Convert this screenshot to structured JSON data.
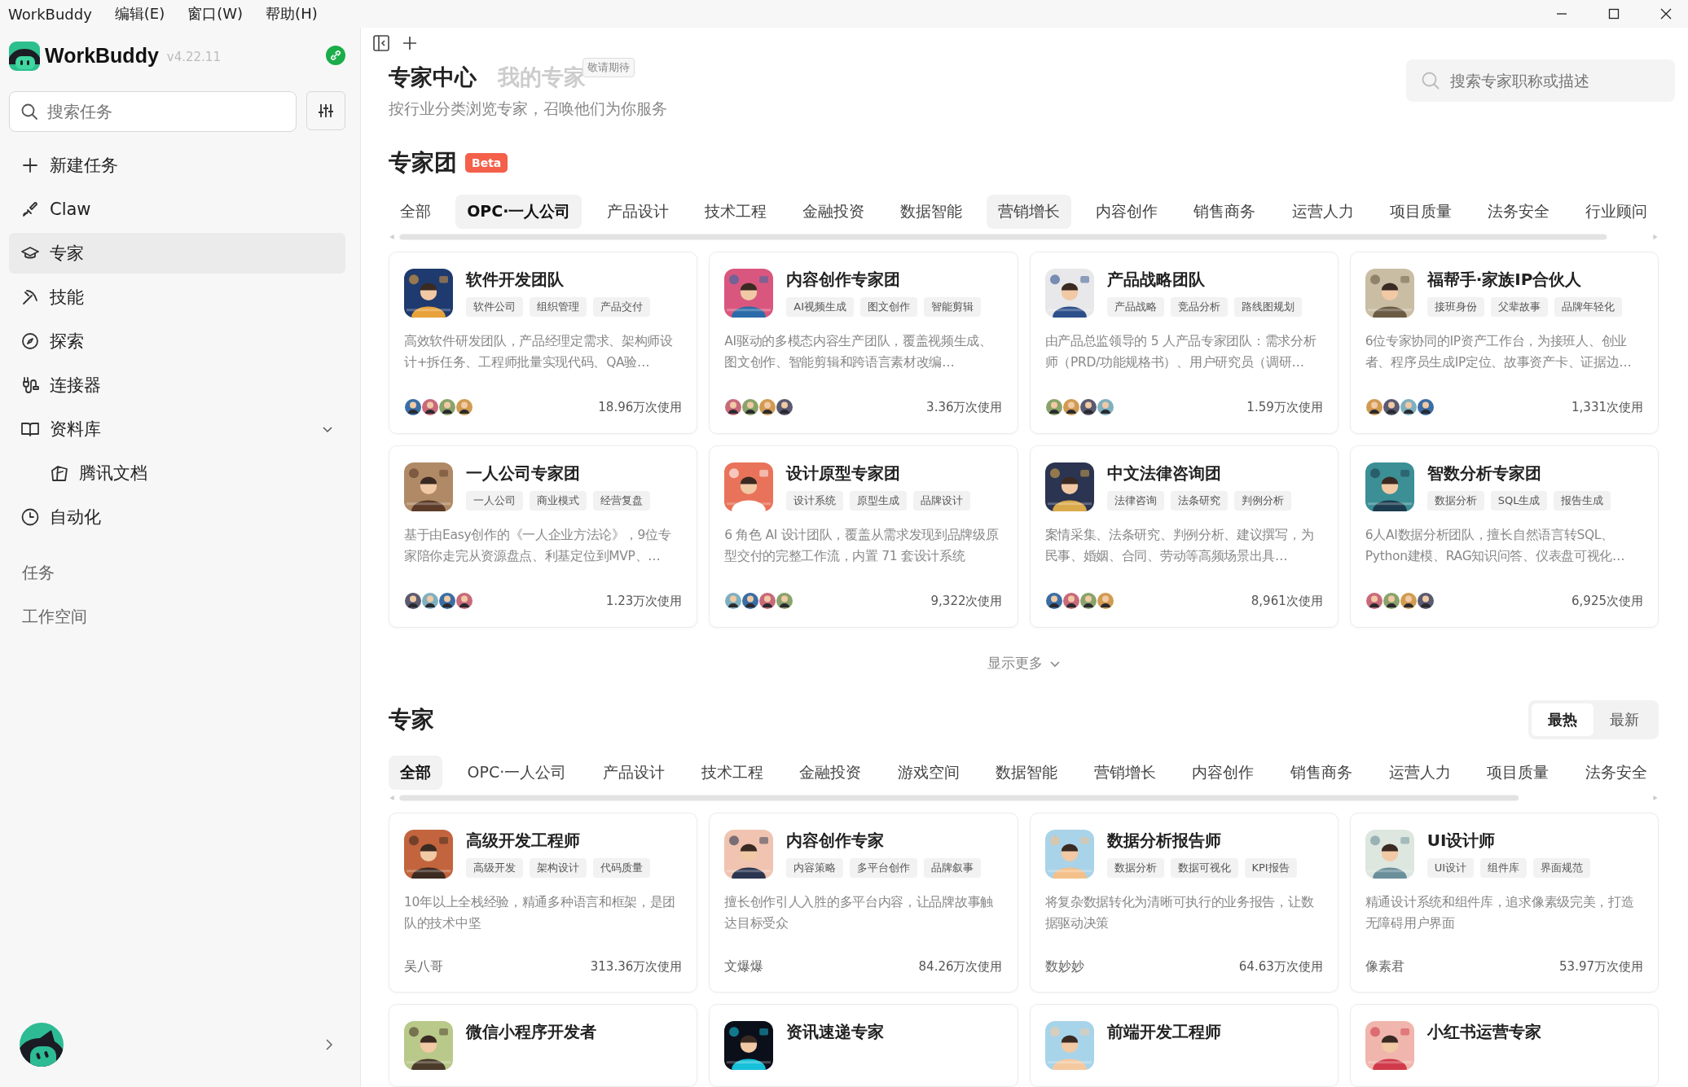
{
  "menubar": {
    "app_name": "WorkBuddy",
    "menus": [
      "编辑(E)",
      "窗口(W)",
      "帮助(H)"
    ]
  },
  "sidebar": {
    "brand": "WorkBuddy",
    "version": "v4.22.11",
    "search": {
      "placeholder": "搜索任务"
    },
    "items": [
      {
        "label": "新建任务",
        "selected": false
      },
      {
        "label": "Claw",
        "selected": false
      },
      {
        "label": "专家",
        "selected": true
      },
      {
        "label": "技能",
        "selected": false
      },
      {
        "label": "探索",
        "selected": false
      },
      {
        "label": "连接器",
        "selected": false
      },
      {
        "label": "资料库",
        "selected": false,
        "expanded": true,
        "children": [
          {
            "label": "腾讯文档",
            "selected": false
          }
        ]
      },
      {
        "label": "自动化",
        "selected": false
      }
    ],
    "sections": [
      "任务",
      "工作空间"
    ]
  },
  "header": {
    "tabs": [
      {
        "label": "专家中心",
        "selected": true
      },
      {
        "label": "我的专家",
        "selected": false,
        "badge": "敬请期待"
      }
    ],
    "subtitle": "按行业分类浏览专家，召唤他们为你服务",
    "search": {
      "placeholder": "搜索专家职称或描述"
    }
  },
  "teams": {
    "title": "专家团",
    "badge": "Beta",
    "tabs": [
      {
        "label": "全部",
        "selected": false,
        "hover": false
      },
      {
        "label": "OPC·一人公司",
        "selected": true,
        "hover": false
      },
      {
        "label": "产品设计",
        "selected": false,
        "hover": false
      },
      {
        "label": "技术工程",
        "selected": false,
        "hover": false
      },
      {
        "label": "金融投资",
        "selected": false,
        "hover": false
      },
      {
        "label": "数据智能",
        "selected": false,
        "hover": false
      },
      {
        "label": "营销增长",
        "selected": false,
        "hover": true
      },
      {
        "label": "内容创作",
        "selected": false,
        "hover": false
      },
      {
        "label": "销售商务",
        "selected": false,
        "hover": false
      },
      {
        "label": "运营人力",
        "selected": false,
        "hover": false
      },
      {
        "label": "项目质量",
        "selected": false,
        "hover": false
      },
      {
        "label": "法务安全",
        "selected": false,
        "hover": false
      },
      {
        "label": "行业顾问",
        "selected": false,
        "hover": false
      }
    ],
    "cards": [
      {
        "title": "软件开发团队",
        "tags": [
          "软件公司",
          "组织管理",
          "产品交付"
        ],
        "description": "高效软件研发团队，产品经理定需求、架构师设计+拆任务、工程师批量实现代码、QA验…",
        "usage": "18.96万次使用"
      },
      {
        "title": "内容创作专家团",
        "tags": [
          "AI视频生成",
          "图文创作",
          "智能剪辑"
        ],
        "description": "AI驱动的多模态内容生产团队，覆盖视频生成、图文创作、智能剪辑和跨语言素材改编…",
        "usage": "3.36万次使用"
      },
      {
        "title": "产品战略团队",
        "tags": [
          "产品战略",
          "竞品分析",
          "路线图规划"
        ],
        "description": "由产品总监领导的 5 人产品专家团队：需求分析师（PRD/功能规格书）、用户研究员（调研…",
        "usage": "1.59万次使用"
      },
      {
        "title": "福帮手·家族IP合伙人",
        "tags": [
          "接班身份",
          "父辈故事",
          "品牌年轻化"
        ],
        "description": "6位专家协同的IP资产工作台，为接班人、创业者、程序员生成IP定位、故事资产卡、证据边…",
        "usage": "1,331次使用"
      },
      {
        "title": "一人公司专家团",
        "tags": [
          "一人公司",
          "商业模式",
          "经营复盘"
        ],
        "description": "基于由Easy创作的《一人企业方法论》，9位专家陪你走完从资源盘点、利基定位到MVP、…",
        "usage": "1.23万次使用"
      },
      {
        "title": "设计原型专家团",
        "tags": [
          "设计系统",
          "原型生成",
          "品牌设计"
        ],
        "description": "6 角色 AI 设计团队，覆盖从需求发现到品牌级原型交付的完整工作流，内置 71 套设计系统",
        "usage": "9,322次使用"
      },
      {
        "title": "中文法律咨询团",
        "tags": [
          "法律咨询",
          "法条研究",
          "判例分析"
        ],
        "description": "案情采集、法条研究、判例分析、建议撰写，为民事、婚姻、合同、劳动等高频场景出具…",
        "usage": "8,961次使用"
      },
      {
        "title": "智数分析专家团",
        "tags": [
          "数据分析",
          "SQL生成",
          "报告生成"
        ],
        "description": "6人AI数据分析团队，擅长自然语言转SQL、Python建模、RAG知识问答、仪表盘可视化…",
        "usage": "6,925次使用"
      }
    ],
    "show_more": "显示更多"
  },
  "experts": {
    "title": "专家",
    "sort": [
      {
        "label": "最热",
        "selected": true
      },
      {
        "label": "最新",
        "selected": false
      }
    ],
    "tabs": [
      {
        "label": "全部",
        "selected": true,
        "hover": false
      },
      {
        "label": "OPC·一人公司",
        "selected": false,
        "hover": false
      },
      {
        "label": "产品设计",
        "selected": false,
        "hover": false
      },
      {
        "label": "技术工程",
        "selected": false,
        "hover": false
      },
      {
        "label": "金融投资",
        "selected": false,
        "hover": false
      },
      {
        "label": "游戏空间",
        "selected": false,
        "hover": false
      },
      {
        "label": "数据智能",
        "selected": false,
        "hover": false
      },
      {
        "label": "营销增长",
        "selected": false,
        "hover": false
      },
      {
        "label": "内容创作",
        "selected": false,
        "hover": false
      },
      {
        "label": "销售商务",
        "selected": false,
        "hover": false
      },
      {
        "label": "运营人力",
        "selected": false,
        "hover": false
      },
      {
        "label": "项目质量",
        "selected": false,
        "hover": false
      },
      {
        "label": "法务安全",
        "selected": false,
        "hover": false
      }
    ],
    "cards": [
      {
        "title": "高级开发工程师",
        "tags": [
          "高级开发",
          "架构设计",
          "代码质量"
        ],
        "description": "10年以上全栈经验，精通多种语言和框架，是团队的技术中坚",
        "author": "吴八哥",
        "usage": "313.36万次使用"
      },
      {
        "title": "内容创作专家",
        "tags": [
          "内容策略",
          "多平台创作",
          "品牌叙事"
        ],
        "description": "擅长创作引人入胜的多平台内容，让品牌故事触达目标受众",
        "author": "文爆爆",
        "usage": "84.26万次使用"
      },
      {
        "title": "数据分析报告师",
        "tags": [
          "数据分析",
          "数据可视化",
          "KPI报告"
        ],
        "description": "将复杂数据转化为清晰可执行的业务报告，让数据驱动决策",
        "author": "数妙妙",
        "usage": "64.63万次使用"
      },
      {
        "title": "UI设计师",
        "tags": [
          "UI设计",
          "组件库",
          "界面规范"
        ],
        "description": "精通设计系统和组件库，追求像素级完美，打造无障碍用户界面",
        "author": "像素君",
        "usage": "53.97万次使用"
      },
      {
        "title": "微信小程序开发者"
      },
      {
        "title": "资讯速递专家"
      },
      {
        "title": "前端开发工程师"
      },
      {
        "title": "小红书运营专家"
      }
    ]
  }
}
